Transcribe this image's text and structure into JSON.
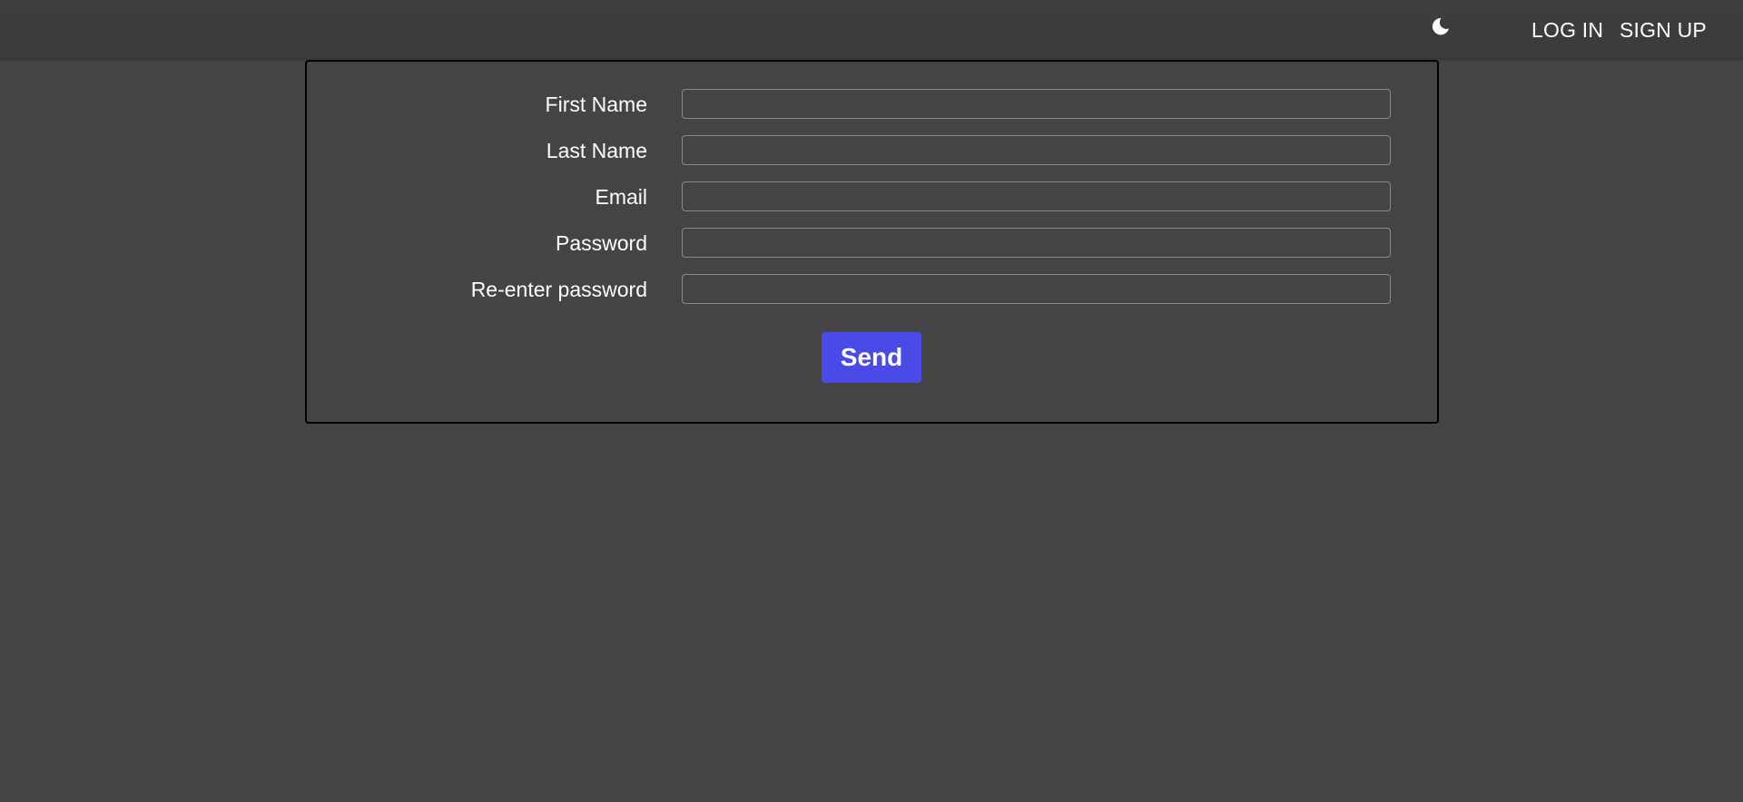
{
  "header": {
    "theme_icon": "moon-icon",
    "login_label": "LOG IN",
    "signup_label": "SIGN UP"
  },
  "form": {
    "fields": [
      {
        "label": "First Name",
        "value": "",
        "placeholder": ""
      },
      {
        "label": "Last Name",
        "value": "",
        "placeholder": ""
      },
      {
        "label": "Email",
        "value": "",
        "placeholder": ""
      },
      {
        "label": "Password",
        "value": "",
        "placeholder": ""
      },
      {
        "label": "Re-enter password",
        "value": "",
        "placeholder": ""
      }
    ],
    "submit_label": "Send"
  },
  "colors": {
    "background": "#444444",
    "header_background": "#3c3c3c",
    "accent": "#4a4ae6",
    "text": "#ffffff"
  }
}
